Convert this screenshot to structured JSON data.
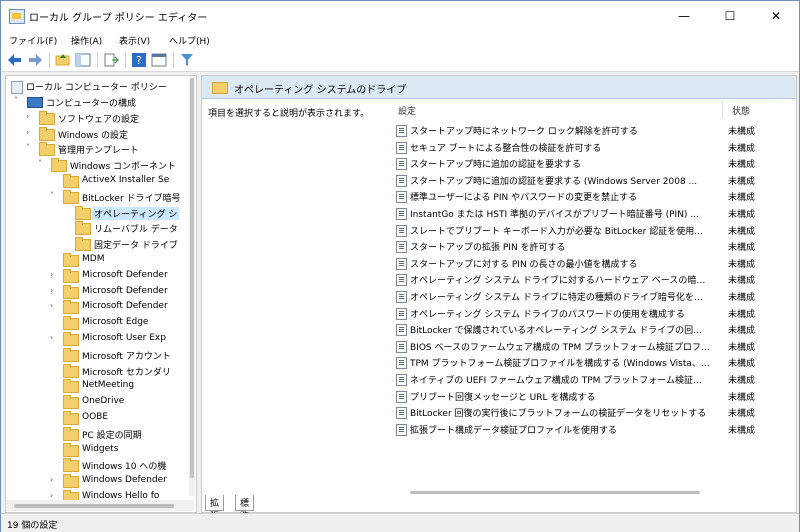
{
  "window": {
    "title": "ローカル グループ ポリシー エディター",
    "minimize": "—",
    "maximize": "☐",
    "close": "✕"
  },
  "menu": [
    "ファイル(F)",
    "操作(A)",
    "表示(V)",
    "ヘルプ(H)"
  ],
  "tree": {
    "root": "ローカル コンピューター ポリシー",
    "items": [
      {
        "label": "コンピューターの構成",
        "level": 1,
        "arrow": "˅",
        "kind": "pc"
      },
      {
        "label": "ソフトウェアの設定",
        "level": 2,
        "arrow": "›"
      },
      {
        "label": "Windows の設定",
        "level": 2,
        "arrow": "›"
      },
      {
        "label": "管理用テンプレート",
        "level": 2,
        "arrow": "˅"
      },
      {
        "label": "Windows コンポーネント",
        "level": 3,
        "arrow": "˅"
      },
      {
        "label": "ActiveX Installer Se",
        "level": 4,
        "arrow": ""
      },
      {
        "label": "BitLocker ドライブ暗号",
        "level": 4,
        "arrow": "˅"
      },
      {
        "label": "オペレーティング シ",
        "level": 5,
        "arrow": "",
        "selected": true
      },
      {
        "label": "リムーバブル データ",
        "level": 5,
        "arrow": ""
      },
      {
        "label": "固定データ ドライブ",
        "level": 5,
        "arrow": ""
      },
      {
        "label": "MDM",
        "level": 4,
        "arrow": ""
      },
      {
        "label": "Microsoft Defender",
        "level": 4,
        "arrow": "›"
      },
      {
        "label": "Microsoft Defender",
        "level": 4,
        "arrow": "›"
      },
      {
        "label": "Microsoft Defender",
        "level": 4,
        "arrow": "›"
      },
      {
        "label": "Microsoft Edge",
        "level": 4,
        "arrow": ""
      },
      {
        "label": "Microsoft User Exp",
        "level": 4,
        "arrow": "›"
      },
      {
        "label": "Microsoft アカウント",
        "level": 4,
        "arrow": ""
      },
      {
        "label": "Microsoft セカンダリ",
        "level": 4,
        "arrow": ""
      },
      {
        "label": "NetMeeting",
        "level": 4,
        "arrow": ""
      },
      {
        "label": "OneDrive",
        "level": 4,
        "arrow": ""
      },
      {
        "label": "OOBE",
        "level": 4,
        "arrow": ""
      },
      {
        "label": "PC 設定の同期",
        "level": 4,
        "arrow": ""
      },
      {
        "label": "Widgets",
        "level": 4,
        "arrow": ""
      },
      {
        "label": "Windows 10 への機",
        "level": 4,
        "arrow": ""
      },
      {
        "label": "Windows Defender",
        "level": 4,
        "arrow": "›"
      },
      {
        "label": "Windows Hello fo",
        "level": 4,
        "arrow": "›"
      }
    ]
  },
  "main": {
    "header": "オペレーティング システムのドライブ",
    "description": "項目を選択すると説明が表示されます。",
    "col_setting": "設定",
    "col_state": "状態",
    "policies": [
      {
        "name": "スタートアップ時にネットワーク ロック解除を許可する",
        "state": "未構成"
      },
      {
        "name": "セキュア ブートによる整合性の検証を許可する",
        "state": "未構成"
      },
      {
        "name": "スタートアップ時に追加の認証を要求する",
        "state": "未構成"
      },
      {
        "name": "スタートアップ時に追加の認証を要求する (Windows Server 2008 ...",
        "state": "未構成"
      },
      {
        "name": "標準ユーザーによる PIN やパスワードの変更を禁止する",
        "state": "未構成"
      },
      {
        "name": "InstantGo または HSTI 準拠のデバイスがプリブート暗証番号 (PIN) ...",
        "state": "未構成"
      },
      {
        "name": "スレートでプリブート キーボード入力が必要な BitLocker 認証を使用...",
        "state": "未構成"
      },
      {
        "name": "スタートアップの拡張 PIN を許可する",
        "state": "未構成"
      },
      {
        "name": "スタートアップに対する PIN の長さの最小値を構成する",
        "state": "未構成"
      },
      {
        "name": "オペレーティング システム ドライブに対するハードウェア ベースの暗号化...",
        "state": "未構成"
      },
      {
        "name": "オペレーティング システム ドライブに特定の種類のドライブ暗号化を適...",
        "state": "未構成"
      },
      {
        "name": "オペレーティング システム ドライブのパスワードの使用を構成する",
        "state": "未構成"
      },
      {
        "name": "BitLocker で保護されているオペレーティング システム ドライブの回復...",
        "state": "未構成"
      },
      {
        "name": "BIOS ベースのファームウェア構成の TPM プラットフォーム検証プロファ...",
        "state": "未構成"
      },
      {
        "name": "TPM プラットフォーム検証プロファイルを構成する (Windows Vista、...",
        "state": "未構成"
      },
      {
        "name": "ネイティブの UEFI ファームウェア構成の TPM プラットフォーム検証プロ...",
        "state": "未構成"
      },
      {
        "name": "プリブート回復メッセージと URL を構成する",
        "state": "未構成"
      },
      {
        "name": "BitLocker 回復の実行後にプラットフォームの検証データをリセットする",
        "state": "未構成"
      },
      {
        "name": "拡張ブート構成データ検証プロファイルを使用する",
        "state": "未構成"
      }
    ]
  },
  "tabs": [
    "拡張",
    "標準"
  ],
  "status": "19 個の設定",
  "colors": {
    "header_bg": "#dce8f4",
    "selection": "#cce8ff",
    "folder": "#f2cf6b"
  }
}
